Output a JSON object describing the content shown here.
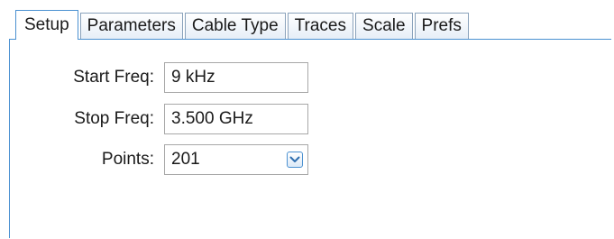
{
  "tabs": [
    {
      "label": "Setup",
      "active": true
    },
    {
      "label": "Parameters",
      "active": false
    },
    {
      "label": "Cable Type",
      "active": false
    },
    {
      "label": "Traces",
      "active": false
    },
    {
      "label": "Scale",
      "active": false
    },
    {
      "label": "Prefs",
      "active": false
    }
  ],
  "setup": {
    "start_freq": {
      "label": "Start Freq:",
      "value": "9 kHz"
    },
    "stop_freq": {
      "label": "Stop Freq:",
      "value": "3.500 GHz"
    },
    "points": {
      "label": "Points:",
      "value": "201"
    }
  },
  "colors": {
    "accent": "#4b91d1",
    "tab_border": "#8aa2bb",
    "field_border": "#a8a8a8"
  },
  "icons": {
    "points_dropdown": "chevron-down-icon"
  }
}
